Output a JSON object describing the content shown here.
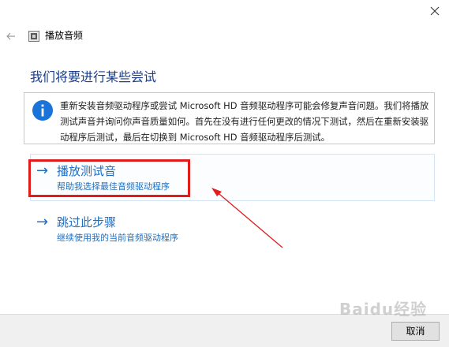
{
  "window": {
    "title": "播放音频",
    "close_icon": "close-icon",
    "back_icon": "back-arrow-icon",
    "app_icon": "speaker-troubleshooter-icon"
  },
  "heading": "我们将要进行某些尝试",
  "info": {
    "icon": "info-icon",
    "text": "重新安装音频驱动程序或尝试 Microsoft HD 音频驱动程序可能会修复声音问题。我们将播放测试声音并询问你声音质量如何。首先在没有进行任何更改的情况下测试，然后在重新安装驱动程序后测试，最后在切换到 Microsoft HD 音频驱动程序后测试。"
  },
  "options": [
    {
      "arrow": "→",
      "title": "播放测试音",
      "subtitle": "帮助我选择最佳音频驱动程序"
    },
    {
      "arrow": "→",
      "title": "跳过此步骤",
      "subtitle": "继续使用我的当前音频驱动程序"
    }
  ],
  "footer": {
    "cancel_label": "取消"
  },
  "watermark": "Baidu经验",
  "colors": {
    "link": "#1f6fc1",
    "heading": "#1a3e8c",
    "info_icon": "#1a73d9",
    "annotation": "#e21b1b"
  }
}
